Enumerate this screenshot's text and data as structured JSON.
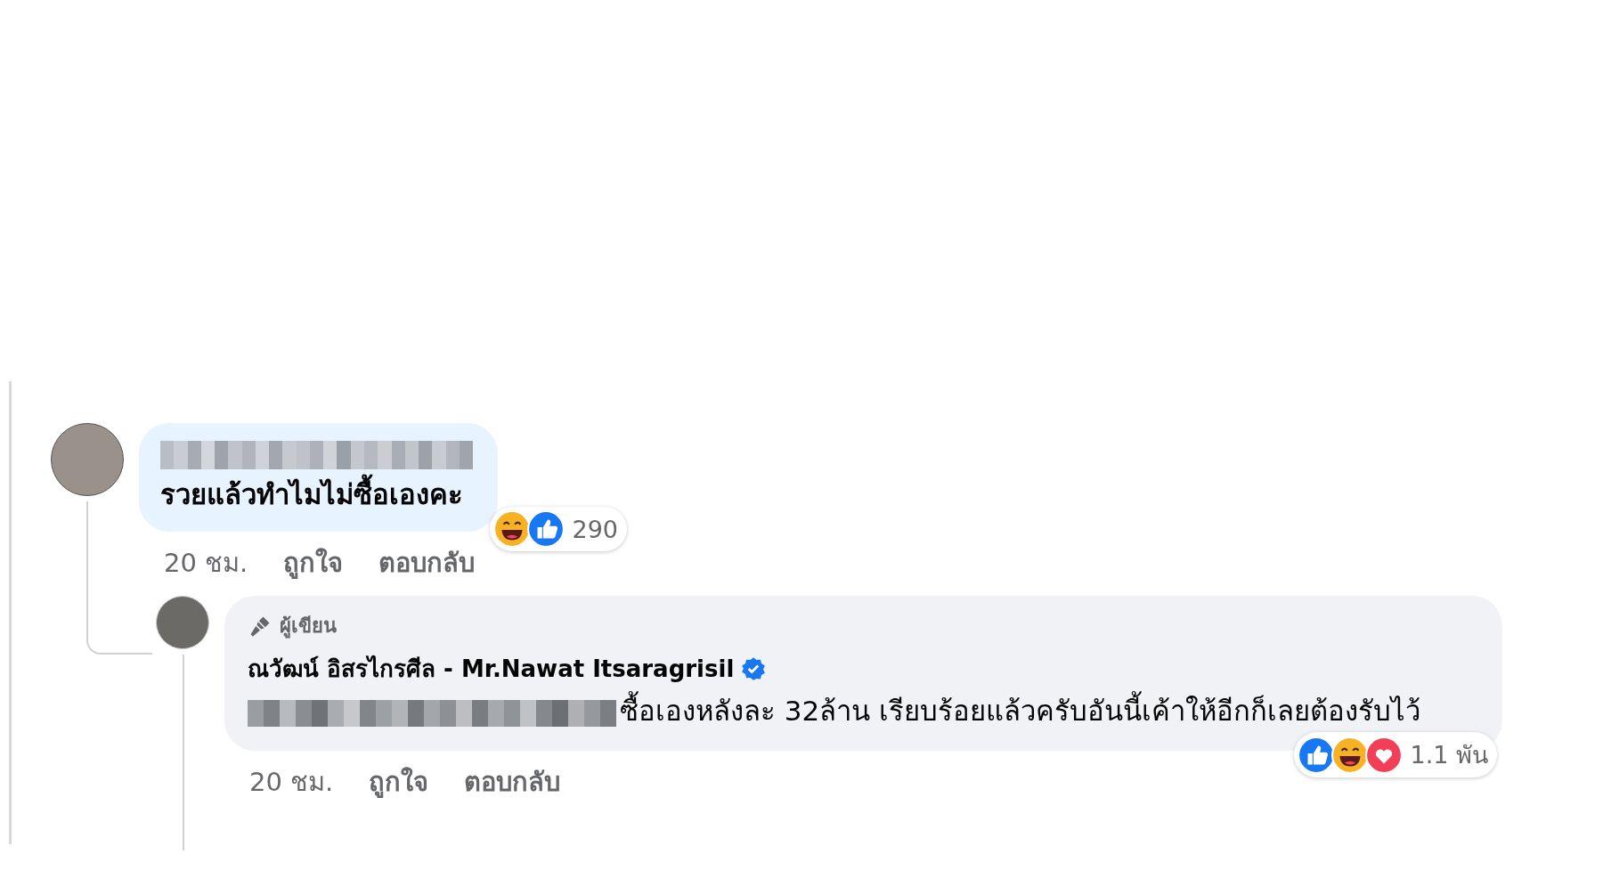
{
  "comment": {
    "redacted_name": true,
    "text": "รวยแล้วทำไมไม่ซื้อเองคะ",
    "reactions": [
      {
        "kind": "haha"
      },
      {
        "kind": "like"
      }
    ],
    "reaction_count": "290",
    "time": "20 ชม.",
    "actions": [
      "ถูกใจ",
      "ตอบกลับ"
    ]
  },
  "reply": {
    "badge": "ผู้เขียน",
    "author": "ณวัฒน์ อิสรไกรศีล - Mr.Nawat Itsaragrisil",
    "verified": true,
    "redacted_prefix": true,
    "text": "ซื้อเองหลังละ 32ล้าน เรียบร้อยแล้วครับอันนี้เค้าให้อีกก็เลยต้องรับไว้",
    "reactions": [
      {
        "kind": "like"
      },
      {
        "kind": "haha"
      },
      {
        "kind": "love"
      }
    ],
    "reaction_count": "1.1 พัน",
    "time": "20 ชม.",
    "actions": [
      "ถูกใจ",
      "ตอบกลับ"
    ]
  }
}
